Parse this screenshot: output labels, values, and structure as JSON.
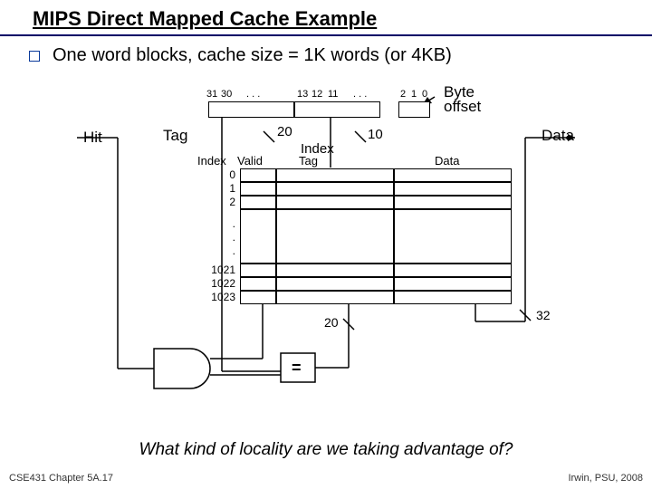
{
  "title": "MIPS Direct Mapped Cache Example",
  "bullet": "One word blocks, cache size = 1K words (or 4KB)",
  "addr": {
    "bits": {
      "b31": "31",
      "b30": "30",
      "dota": ". . .",
      "b13": "13",
      "b12": "12",
      "b11": "11",
      "dotb": ". . .",
      "b2": "2",
      "b1": "1",
      "b0": "0"
    },
    "byte_offset": "Byte\noffset"
  },
  "labels": {
    "hit": "Hit",
    "tag": "Tag",
    "twenty_a": "20",
    "index_word": "Index",
    "ten": "10",
    "data": "Data"
  },
  "table": {
    "h_index": "Index",
    "h_valid": "Valid",
    "h_tag": "Tag",
    "h_data": "Data",
    "rows_top": [
      "0",
      "1",
      "2"
    ],
    "dots": [
      ".",
      ".",
      "."
    ],
    "rows_bot": [
      "1021",
      "1022",
      "1023"
    ]
  },
  "out": {
    "tag20": "20",
    "data32": "32",
    "eq": "="
  },
  "question": "What kind of locality are we taking advantage of?",
  "footer_left": "CSE431 Chapter 5A.17",
  "footer_right": "Irwin, PSU, 2008"
}
